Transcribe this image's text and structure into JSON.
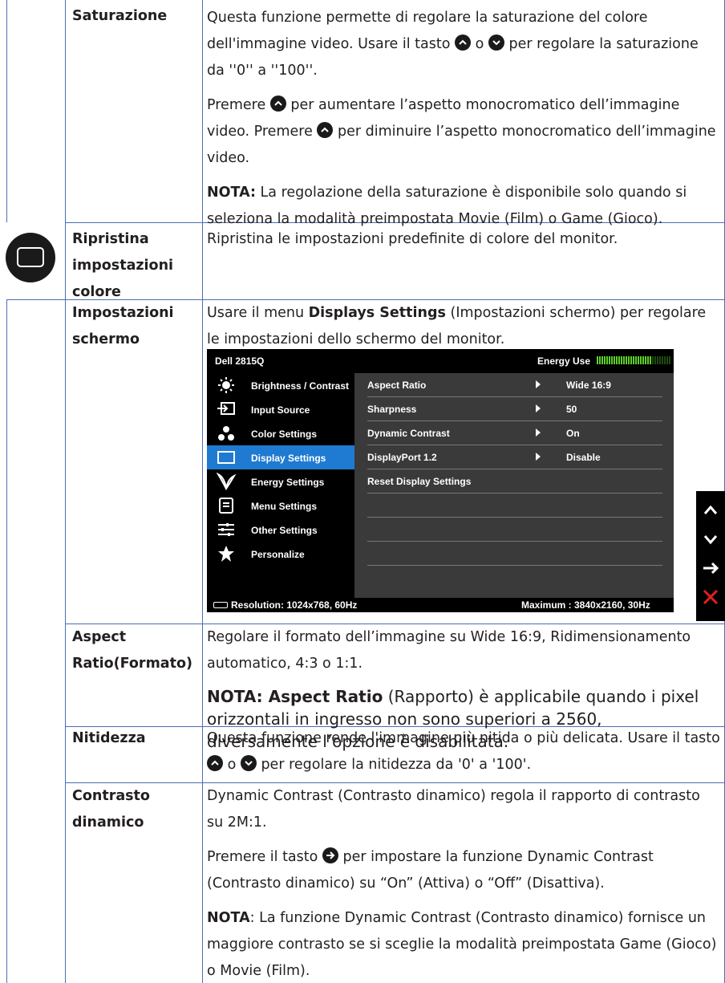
{
  "rows": {
    "saturazione": {
      "label": "Saturazione",
      "p1_a": "Questa funzione permette di regolare la saturazione del colore dell'immagine video. Usare il tasto",
      "p1_b": "o",
      "p1_c": "per regolare la saturazione da ''0'' a ''100''.",
      "p2_a": "Premere",
      "p2_b": "per aumentare l’aspetto monocromatico dell’immagine video. Premere",
      "p2_c": "per diminuire l’aspetto monocromatico dell’immagine video.",
      "note_label": "NOTA:",
      "note_text": "La regolazione della saturazione è disponibile solo quando si seleziona la modalità preimpostata Movie (Film) o Game (Gioco)."
    },
    "ripristina": {
      "label_1": "Ripristina",
      "label_2": "impostazioni",
      "label_3": "colore",
      "text": "Ripristina le impostazioni predefinite di colore del monitor."
    },
    "impostazioni": {
      "label_1": "Impostazioni",
      "label_2": "schermo",
      "p_a": "Usare il menu",
      "p_b": "Displays Settings",
      "p_c": "(Impostazioni schermo) per regolare le impostazioni dello schermo del monitor."
    },
    "aspect": {
      "label_1": "Aspect",
      "label_2": "Ratio(Formato)",
      "p1": "Regolare il formato dell’immagine su Wide 16:9, Ridimensionamento automatico, 4:3 o 1:1.",
      "note_label": "NOTA: Aspect Ratio",
      "note_text": "(Rapporto) è applicabile quando i pixel orizzontali in ingresso non sono superiori a 2560, diversamente l’opzione è disabilitata."
    },
    "nitidezza": {
      "label": "Nitidezza",
      "p_a": "Questa funzione rende l'immagine più nitida o più delicata. Usare il tasto",
      "p_b": "o",
      "p_c": "per regolare la nitidezza da '0' a '100'."
    },
    "contrasto": {
      "label_1": "Contrasto",
      "label_2": "dinamico",
      "p1": "Dynamic Contrast (Contrasto dinamico) regola il rapporto di contrasto su 2M:1.",
      "p2_a": "Premere il tasto",
      "p2_b": "per impostare la funzione Dynamic Contrast (Contrasto dinamico) su “On” (Attiva) o “Off” (Disattiva).",
      "note_label": "NOTA",
      "note_text": ": La funzione Dynamic Contrast (Contrasto dinamico) fornisce un maggiore contrasto se si sceglie la modalità preimpostata Game (Gioco) o Movie (Film)."
    }
  },
  "osd": {
    "title": "Dell 2815Q",
    "energy_label": "Energy Use",
    "energy_level": 0.75,
    "menu": [
      {
        "label": "Brightness / Contrast",
        "icon": "brightness-icon"
      },
      {
        "label": "Input Source",
        "icon": "input-source-icon"
      },
      {
        "label": "Color Settings",
        "icon": "color-settings-icon"
      },
      {
        "label": "Display Settings",
        "icon": "display-settings-icon",
        "active": true
      },
      {
        "label": "Energy Settings",
        "icon": "energy-settings-icon"
      },
      {
        "label": "Menu Settings",
        "icon": "menu-settings-icon"
      },
      {
        "label": "Other Settings",
        "icon": "other-settings-icon"
      },
      {
        "label": "Personalize",
        "icon": "personalize-icon"
      }
    ],
    "settings": [
      {
        "label": "Aspect Ratio",
        "value": "Wide 16:9"
      },
      {
        "label": "Sharpness",
        "value": "50"
      },
      {
        "label": "Dynamic Contrast",
        "value": "On"
      },
      {
        "label": "DisplayPort 1.2",
        "value": "Disable"
      },
      {
        "label": "Reset Display Settings",
        "value": ""
      }
    ],
    "resolution": "Resolution: 1024x768,  60Hz",
    "maximum": "Maximum : 3840x2160,  30Hz"
  },
  "colors": {
    "grid": "#4a6fb4",
    "osd_accent": "#1f7ad1",
    "energy_green": "#5fcf2a",
    "close_red": "#e0201f"
  }
}
